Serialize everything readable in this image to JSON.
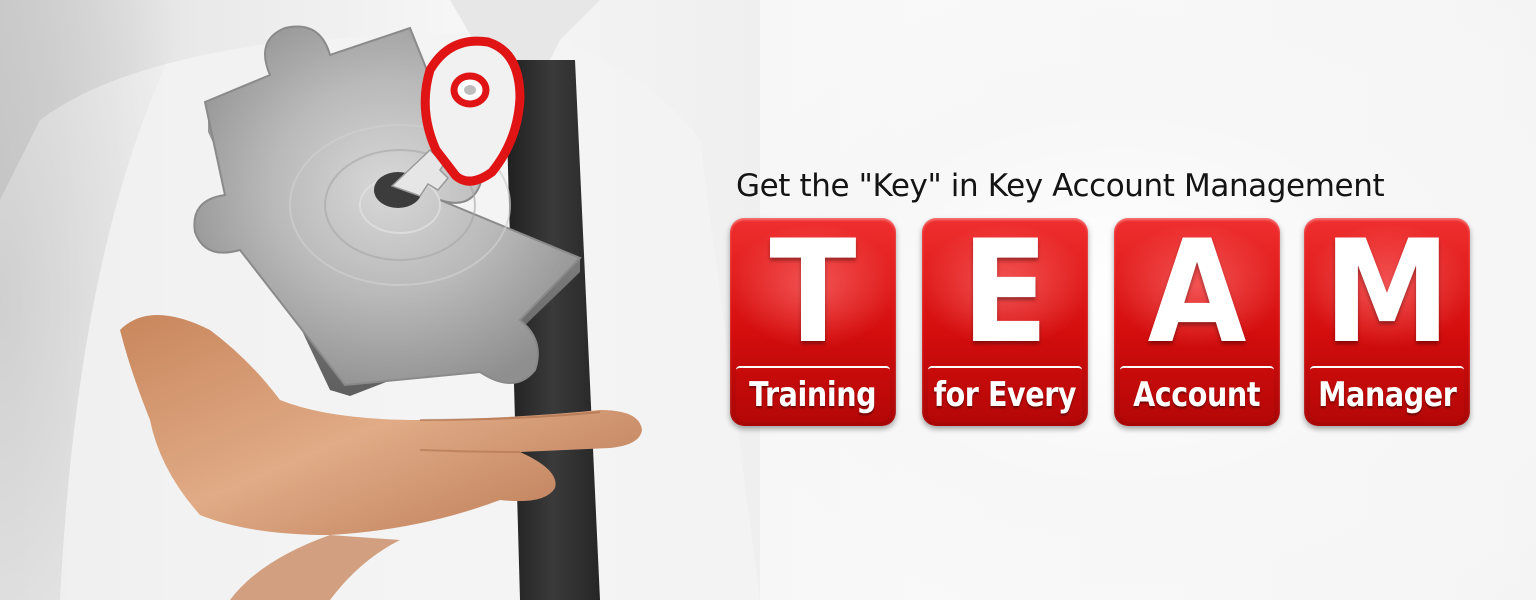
{
  "headline": "Get the \"Key\" in Key Account Management",
  "tiles": [
    {
      "letter": "T",
      "word": "Training"
    },
    {
      "letter": "E",
      "word": "for Every"
    },
    {
      "letter": "A",
      "word": "Account"
    },
    {
      "letter": "M",
      "word": "Manager"
    }
  ],
  "illustration": {
    "subject": "hand holding a floating metal puzzle piece with a red key",
    "icons": [
      "puzzle-piece-icon",
      "key-icon",
      "hand-icon"
    ]
  },
  "colors": {
    "tile_red": "#d40d0d",
    "tile_red_light": "#ef2f2f",
    "tile_red_dark": "#a80606",
    "key_red": "#e01414",
    "metal": "#a9a9a9",
    "text_dark": "#141414",
    "shirt": "#f4f4f4",
    "tie": "#2b2b2b",
    "skin": "#d9a27a"
  }
}
